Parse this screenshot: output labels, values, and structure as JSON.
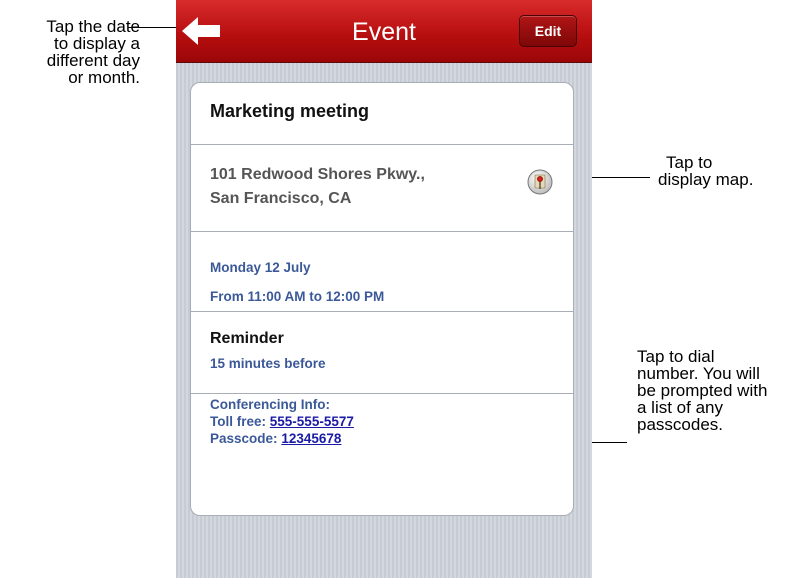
{
  "callouts": {
    "date_line1": "Tap the date",
    "date_line2": "to display a",
    "date_line3": "different day",
    "date_line4": "or month.",
    "map_line1": "Tap to",
    "map_line2": "display map.",
    "dial_line1": "Tap to dial",
    "dial_line2": "number. You will",
    "dial_line3": "be prompted with",
    "dial_line4": "a list of any",
    "dial_line5": "passcodes."
  },
  "nav": {
    "title": "Event",
    "edit_label": "Edit",
    "back_icon": "back-arrow-icon"
  },
  "event": {
    "title": "Marketing meeting",
    "address_line1": "101 Redwood Shores Pkwy.,",
    "address_line2": "San Francisco, CA",
    "map_icon": "map-pin-icon",
    "date": "Monday 12 July",
    "time": "From 11:00 AM to 12:00 PM",
    "reminder_label": "Reminder",
    "reminder_value": "15 minutes before",
    "conf_label": "Conferencing Info:",
    "toll_label": "Toll free:",
    "toll_number": "555-555-5577",
    "passcode_label": "Passcode:",
    "passcode_value": "12345678"
  },
  "colors": {
    "nav_red": "#b80f10",
    "link_blue": "#1a1aa6",
    "label_blue": "#3b5998"
  }
}
